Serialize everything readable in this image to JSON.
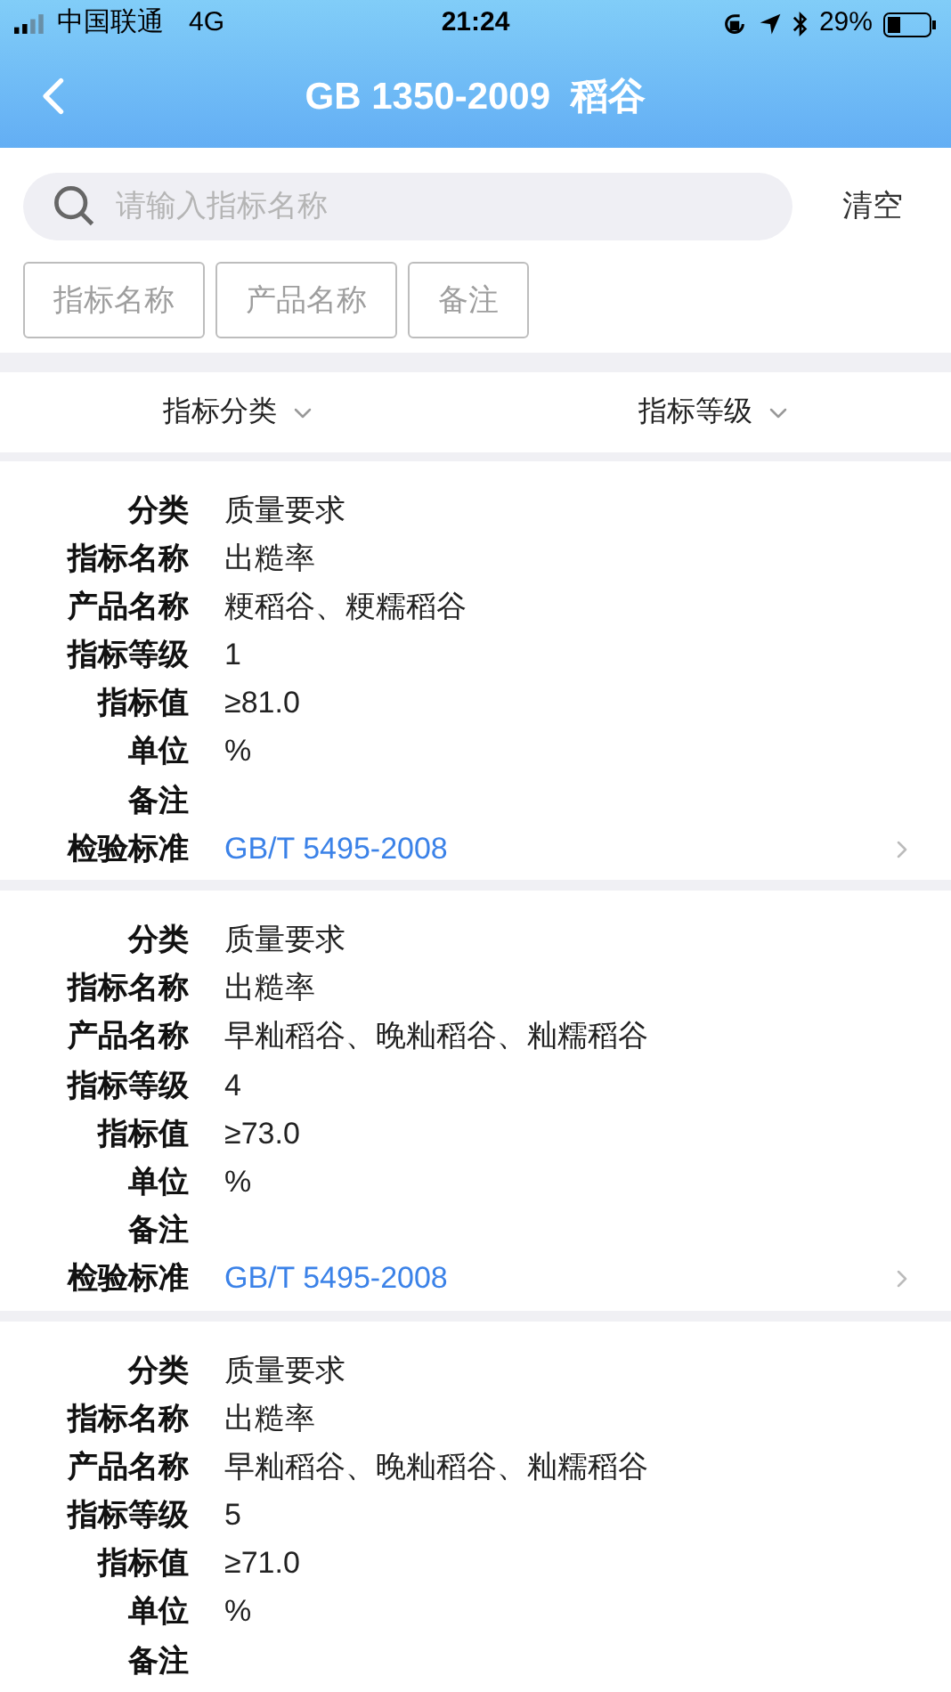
{
  "status_bar": {
    "carrier": "中国联通",
    "network": "4G",
    "time": "21:24",
    "battery": "29%"
  },
  "header": {
    "title": "GB 1350-2009  稻谷"
  },
  "search": {
    "placeholder": "请输入指标名称",
    "clear": "清空"
  },
  "filters": [
    {
      "label": "指标名称",
      "selected": false
    },
    {
      "label": "产品名称",
      "selected": false
    },
    {
      "label": "备注",
      "selected": false
    }
  ],
  "sorts": [
    {
      "label": "指标分类"
    },
    {
      "label": "指标等级"
    }
  ],
  "cards": [
    {
      "rows": [
        {
          "label": "分类",
          "value": "质量要求"
        },
        {
          "label": "指标名称",
          "value": "出糙率"
        },
        {
          "label": "产品名称",
          "value": "粳稻谷、粳糯稻谷"
        },
        {
          "label": "指标等级",
          "value": "1"
        },
        {
          "label": "指标值",
          "value": "≥81.0"
        },
        {
          "label": "单位",
          "value": "%"
        },
        {
          "label": "备注"
        },
        {
          "label": "检验标准",
          "value": "GB/T 5495-2008",
          "kind": "link"
        }
      ]
    },
    {
      "rows": [
        {
          "label": "分类",
          "value": "质量要求"
        },
        {
          "label": "指标名称",
          "value": "出糙率"
        },
        {
          "label": "产品名称",
          "value": "早籼稻谷、晚籼稻谷、籼糯稻谷"
        },
        {
          "label": "指标等级",
          "value": "4"
        },
        {
          "label": "指标值",
          "value": "≥73.0"
        },
        {
          "label": "单位",
          "value": "%"
        },
        {
          "label": "备注"
        },
        {
          "label": "检验标准",
          "value": "GB/T 5495-2008",
          "kind": "link"
        }
      ]
    },
    {
      "rows": [
        {
          "label": "分类",
          "value": "质量要求"
        },
        {
          "label": "指标名称",
          "value": "出糙率"
        },
        {
          "label": "产品名称",
          "value": "早籼稻谷、晚籼稻谷、籼糯稻谷"
        },
        {
          "label": "指标等级",
          "value": "5"
        },
        {
          "label": "指标值",
          "value": "≥71.0"
        },
        {
          "label": "单位",
          "value": "%"
        },
        {
          "label": "备注"
        }
      ]
    }
  ]
}
